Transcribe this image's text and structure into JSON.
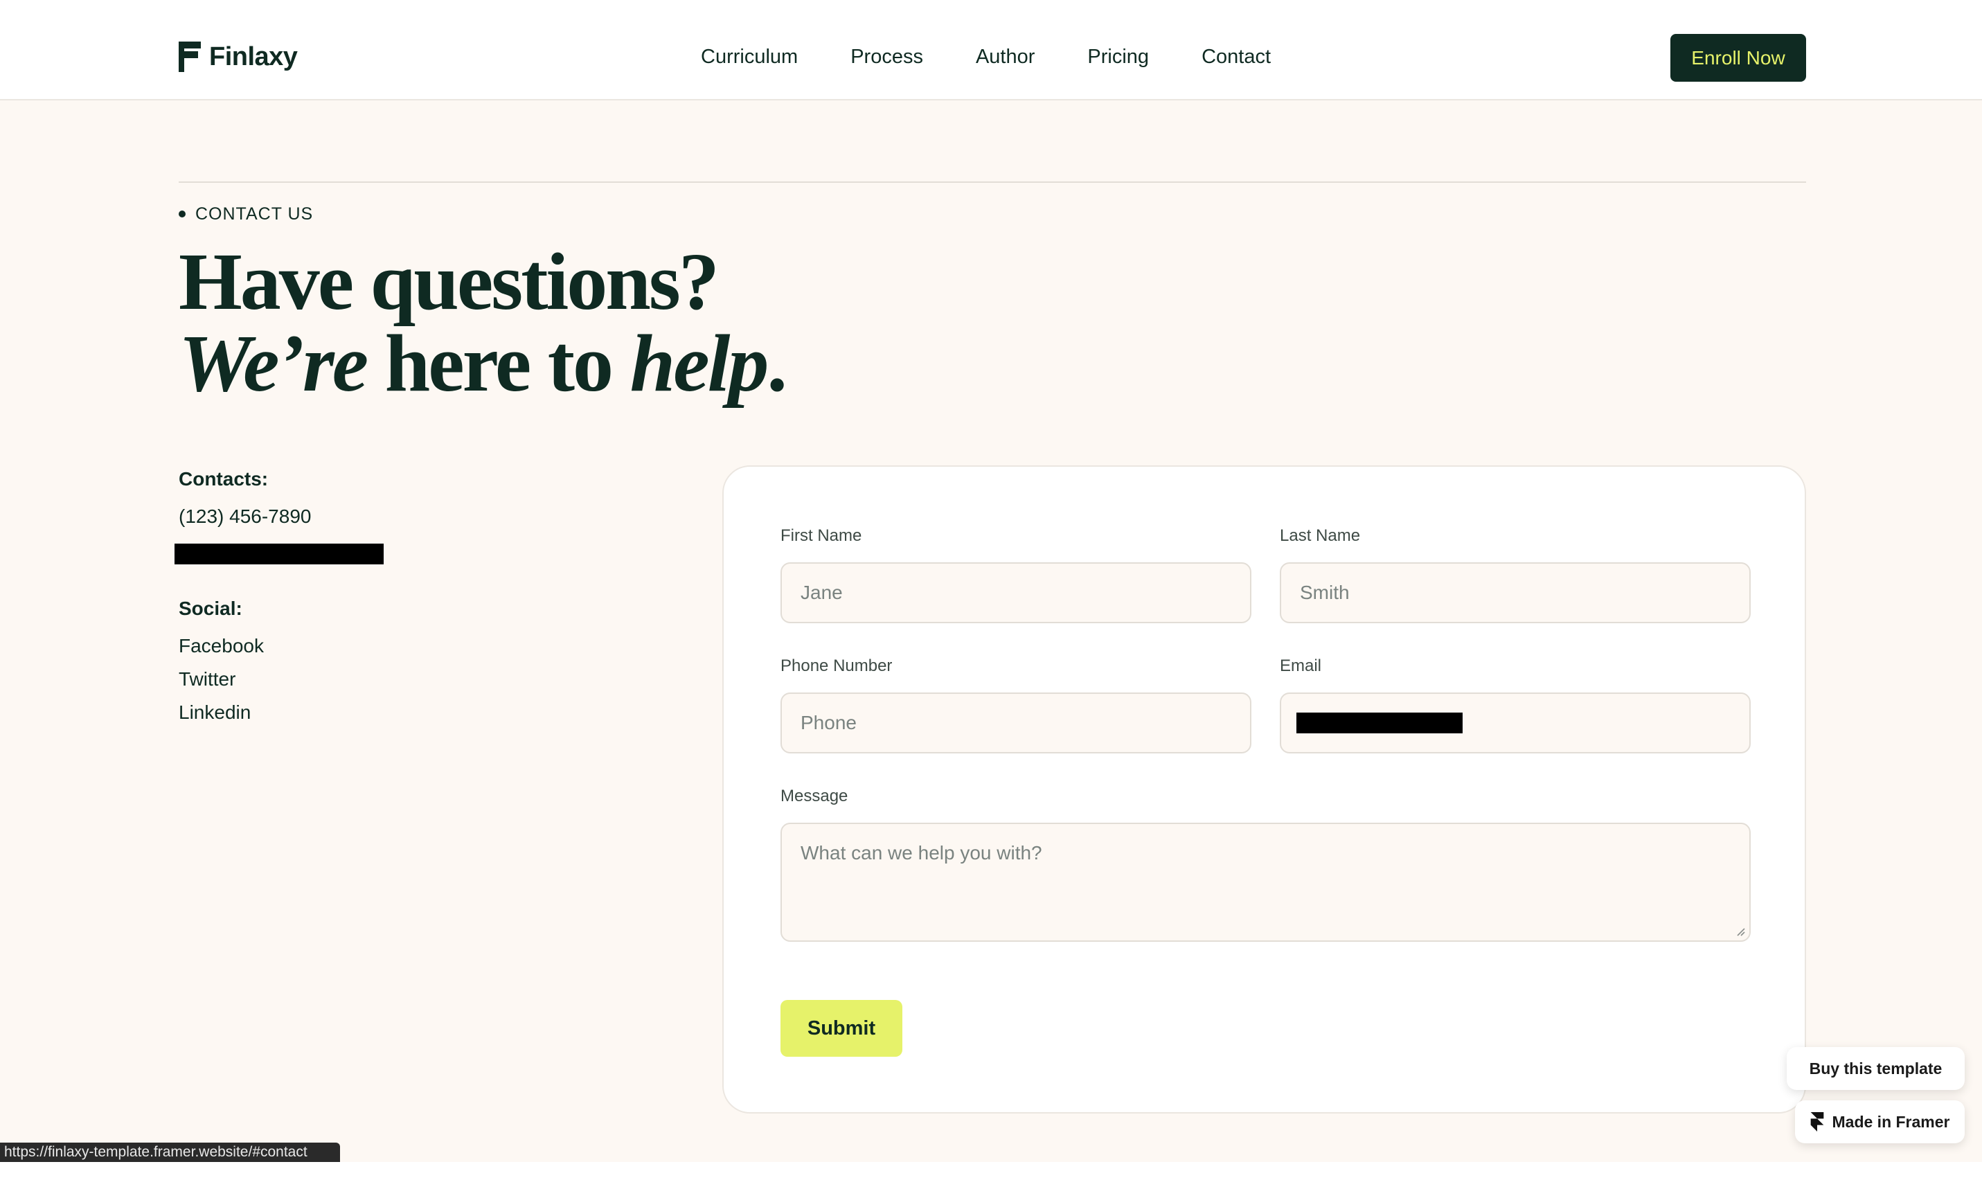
{
  "brand": {
    "name": "Finlaxy",
    "logo_icon": "finlaxy-flag-logo-icon",
    "primary_color": "#0f2a22",
    "accent_color": "#e6f26a",
    "background_color": "#fdf8f3"
  },
  "nav": {
    "items": [
      {
        "label": "Curriculum"
      },
      {
        "label": "Process"
      },
      {
        "label": "Author"
      },
      {
        "label": "Pricing"
      },
      {
        "label": "Contact"
      }
    ],
    "cta_label": "Enroll Now"
  },
  "section": {
    "eyebrow": "CONTACT US",
    "heading": {
      "line1": "Have questions?",
      "line2_italic_a": "We’re",
      "line2_plain": " here to ",
      "line2_italic_b": "help",
      "line2_end": "."
    }
  },
  "contacts": {
    "title": "Contacts:",
    "phone": "(123) 456-7890",
    "email_redacted": true
  },
  "social": {
    "title": "Social:",
    "links": [
      "Facebook",
      "Twitter",
      "Linkedin"
    ]
  },
  "form": {
    "first_name": {
      "label": "First Name",
      "placeholder": "Jane"
    },
    "last_name": {
      "label": "Last Name",
      "placeholder": "Smith"
    },
    "phone": {
      "label": "Phone Number",
      "placeholder": "Phone"
    },
    "email": {
      "label": "Email",
      "value_redacted": true
    },
    "message": {
      "label": "Message",
      "placeholder": "What can we help you with?"
    },
    "submit_label": "Submit"
  },
  "badges": {
    "buy_template": "Buy this template",
    "made_in_framer": "Made in Framer",
    "framer_icon": "framer-logo-icon"
  },
  "status_bar": {
    "url": "https://finlaxy-template.framer.website/#contact"
  }
}
